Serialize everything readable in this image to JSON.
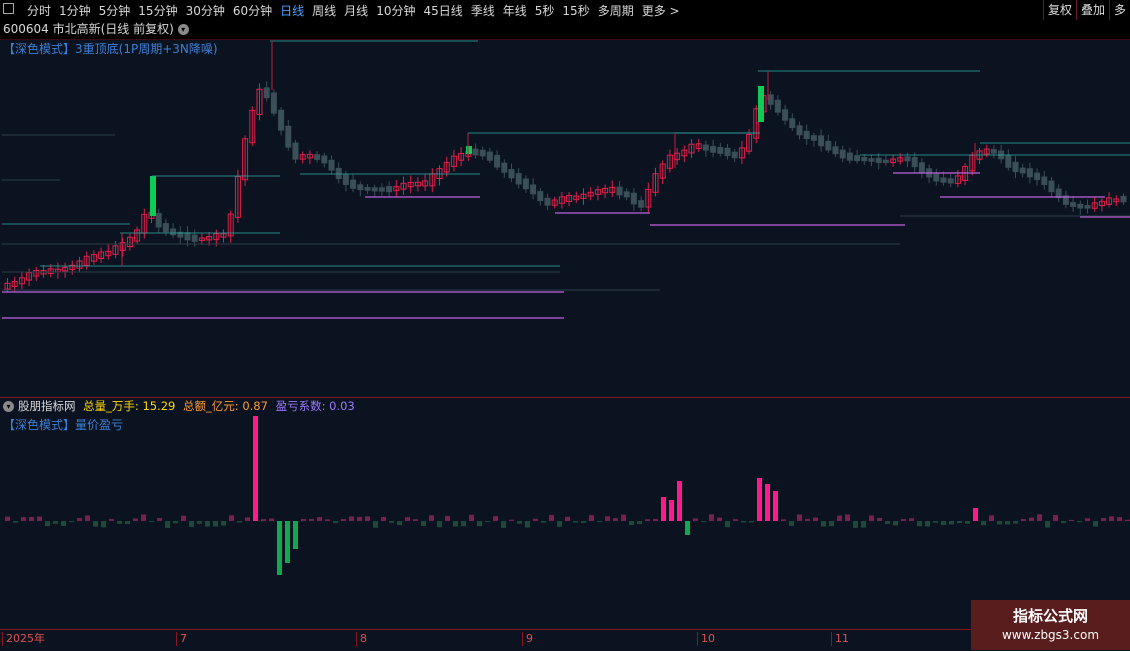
{
  "toolbar": {
    "tabs": [
      "分时",
      "1分钟",
      "5分钟",
      "15分钟",
      "30分钟",
      "60分钟",
      "日线",
      "周线",
      "月线",
      "10分钟",
      "45日线",
      "季线",
      "年线",
      "5秒",
      "15秒",
      "多周期",
      "更多 >"
    ],
    "active_tab": "日线",
    "right_buttons": [
      "复权",
      "叠加",
      "多"
    ]
  },
  "header": {
    "code_name": "600604 市北高新(日线 前复权)"
  },
  "main_panel": {
    "mode_label": "【深色模式】3重顶底(1P周期+3N降噪)"
  },
  "sub_panel": {
    "title": "股朋指标网",
    "metric1_label": "总量_万手:",
    "metric1_value": "15.29",
    "metric2_label": "总额_亿元:",
    "metric2_value": "0.87",
    "metric3_label": "盈亏系数:",
    "metric3_value": "0.03",
    "mode_label": "【深色模式】量价盈亏"
  },
  "x_axis": {
    "ticks": [
      "2025年",
      "7",
      "8",
      "9",
      "10",
      "11"
    ]
  },
  "watermark": {
    "line1": "指标公式网",
    "line2": "www.zbgs3.com"
  },
  "colors": {
    "background": "#0b1320",
    "up_red": "#e0204a",
    "down_gray": "#3a4f58",
    "limit_green": "#0fca55",
    "resistance_cyan": "#2aa8a0",
    "support_violet": "#c060e0",
    "volume_pink": "#ff1a8c",
    "volume_green": "#10a850",
    "tab_active": "#4aa3ff"
  }
}
